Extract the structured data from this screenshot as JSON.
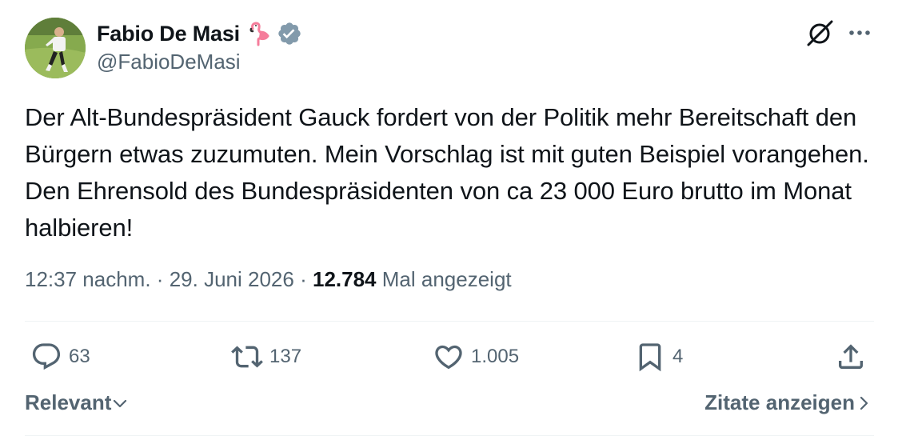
{
  "author": {
    "display_name": "Fabio De Masi",
    "handle": "@FabioDeMasi"
  },
  "tweet": {
    "text": "Der Alt-Bundespräsident Gauck fordert von der Politik mehr Bereitschaft den Bürgern etwas zuzumuten. Mein Vorschlag ist mit guten Beispiel vorangehen. Den Ehrensold des Bundespräsidenten von ca 23 000 Euro brutto im Monat halbieren!",
    "time": "12:37 nachm.",
    "separator": "·",
    "date": "29. Juni 2026",
    "views_count": "12.784",
    "views_label": "Mal angezeigt"
  },
  "actions": {
    "replies": "63",
    "reposts": "137",
    "likes": "1.005",
    "bookmarks": "4"
  },
  "footer": {
    "sort_label": "Relevant",
    "quotes_label": "Zitate anzeigen"
  },
  "icons": {
    "emoji": "flamingo-emoji-icon",
    "verified": "verified-badge-icon",
    "grok": "grok-icon",
    "more": "more-icon",
    "reply": "reply-icon",
    "repost": "repost-icon",
    "like": "like-icon",
    "bookmark": "bookmark-icon",
    "share": "share-icon"
  },
  "colors": {
    "text_primary": "#0f1419",
    "text_secondary": "#536471",
    "verified_badge": "#829aab",
    "divider": "#eff3f4"
  }
}
